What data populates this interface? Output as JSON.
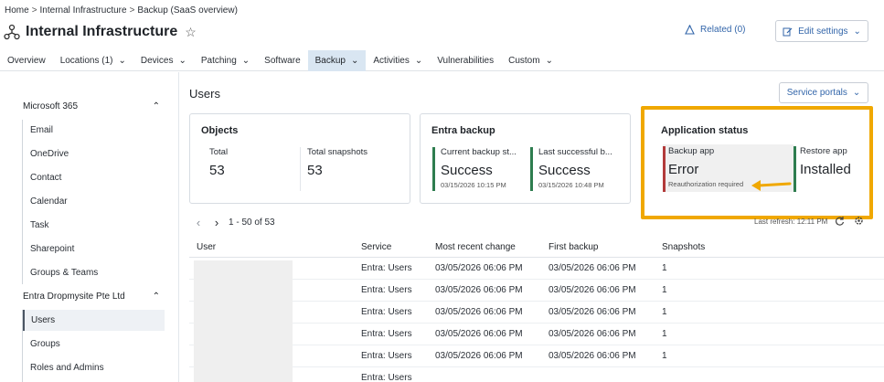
{
  "breadcrumb": {
    "home": "Home",
    "sep": ">",
    "site": "Internal Infrastructure",
    "page": "Backup (SaaS overview)"
  },
  "header": {
    "title": "Internal Infrastructure",
    "related_label": "Related (0)",
    "edit_label": "Edit settings"
  },
  "tabs": [
    {
      "label": "Overview"
    },
    {
      "label": "Locations (1)"
    },
    {
      "label": "Devices"
    },
    {
      "label": "Patching"
    },
    {
      "label": "Software"
    },
    {
      "label": "Backup"
    },
    {
      "label": "Activities"
    },
    {
      "label": "Vulnerabilities"
    },
    {
      "label": "Custom"
    }
  ],
  "sidebar": {
    "group1": "Microsoft 365",
    "group1_items": [
      "Email",
      "OneDrive",
      "Contact",
      "Calendar",
      "Task",
      "Sharepoint",
      "Groups & Teams"
    ],
    "group2": "Entra Dropmysite Pte Ltd",
    "group2_items": [
      "Users",
      "Groups",
      "Roles and Admins"
    ]
  },
  "main": {
    "title": "Users",
    "portals_label": "Service portals"
  },
  "objects": {
    "title": "Objects",
    "total_label": "Total",
    "total_value": "53",
    "snapshots_label": "Total snapshots",
    "snapshots_value": "53"
  },
  "entra": {
    "title": "Entra backup",
    "current_label": "Current backup st...",
    "current_value": "Success",
    "current_date": "03/15/2026 10:15 PM",
    "last_label": "Last successful b...",
    "last_value": "Success",
    "last_date": "03/15/2026 10:48 PM"
  },
  "app_status": {
    "title": "Application status",
    "backup_label": "Backup app",
    "backup_value": "Error",
    "backup_note": "Reauthorization required",
    "restore_label": "Restore app",
    "restore_value": "Installed"
  },
  "pager": {
    "range": "1 - 50 of 53",
    "refresh": "Last refresh: 12:11 PM"
  },
  "table": {
    "headers": {
      "user": "User",
      "service": "Service",
      "recent": "Most recent change",
      "first": "First backup",
      "snapshots": "Snapshots"
    },
    "rows": [
      {
        "service": "Entra: Users",
        "recent": "03/05/2026 06:06 PM",
        "first": "03/05/2026 06:06 PM",
        "snapshots": "1"
      },
      {
        "service": "Entra: Users",
        "recent": "03/05/2026 06:06 PM",
        "first": "03/05/2026 06:06 PM",
        "snapshots": "1"
      },
      {
        "service": "Entra: Users",
        "recent": "03/05/2026 06:06 PM",
        "first": "03/05/2026 06:06 PM",
        "snapshots": "1"
      },
      {
        "service": "Entra: Users",
        "recent": "03/05/2026 06:06 PM",
        "first": "03/05/2026 06:06 PM",
        "snapshots": "1"
      },
      {
        "service": "Entra: Users",
        "recent": "03/05/2026 06:06 PM",
        "first": "03/05/2026 06:06 PM",
        "snapshots": "1"
      },
      {
        "service": "Entra: Users",
        "recent": "",
        "first": "",
        "snapshots": ""
      }
    ]
  },
  "colors": {
    "accent": "#3366aa",
    "success": "#2e7d4f",
    "error": "#b23a3a",
    "highlight": "#f0a800"
  }
}
